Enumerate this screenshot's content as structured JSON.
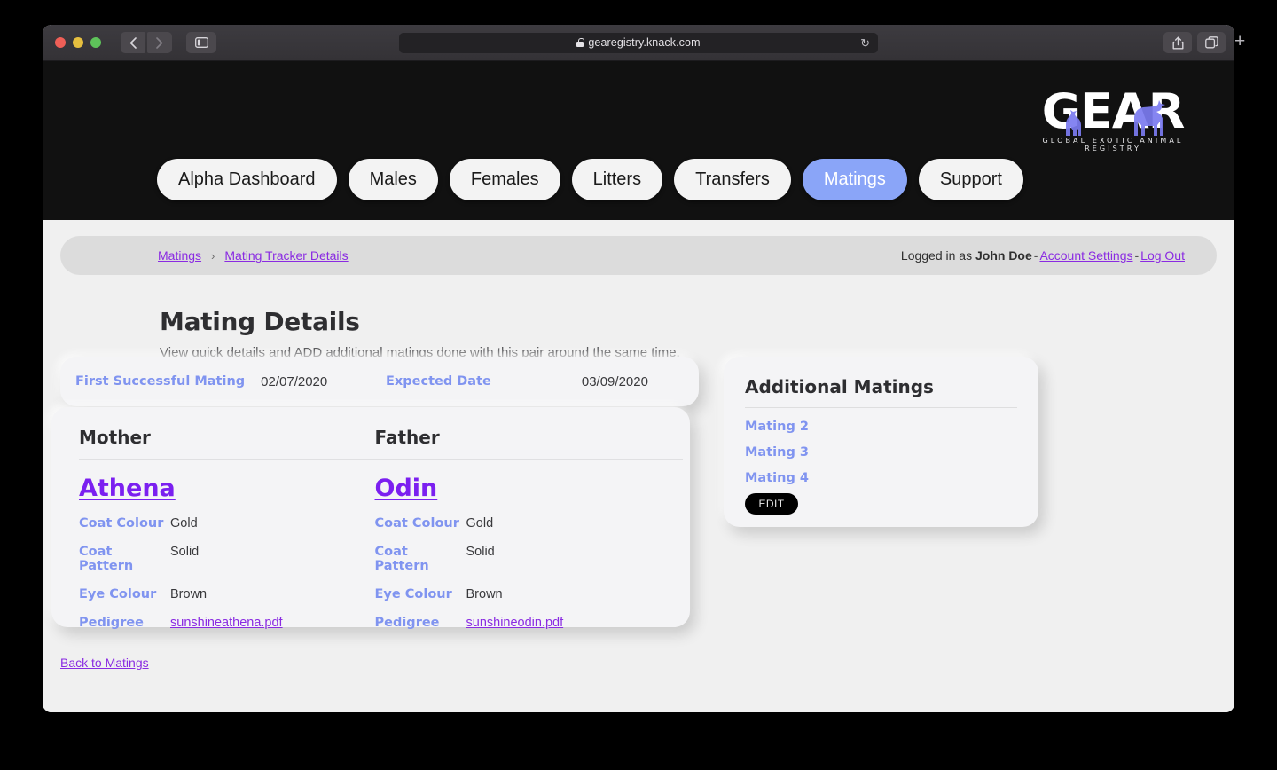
{
  "browser": {
    "url": "gearegistry.knack.com",
    "lock_icon": "lock-icon",
    "reload_icon": "↻",
    "back_icon": "‹",
    "forward_icon": "›",
    "sidebar_icon": "▥",
    "share_icon": "⇧",
    "tabs_icon": "❐",
    "newtab_icon": "+"
  },
  "site": {
    "logo_word": "GEAR",
    "logo_tagline": "GLOBAL EXOTIC ANIMAL REGISTRY"
  },
  "nav": {
    "items": [
      {
        "label": "Alpha Dashboard",
        "active": false
      },
      {
        "label": "Males",
        "active": false
      },
      {
        "label": "Females",
        "active": false
      },
      {
        "label": "Litters",
        "active": false
      },
      {
        "label": "Transfers",
        "active": false
      },
      {
        "label": "Matings",
        "active": true
      },
      {
        "label": "Support",
        "active": false
      }
    ]
  },
  "breadcrumb": {
    "items": [
      "Matings",
      "Mating Tracker Details"
    ],
    "separator": "›"
  },
  "account": {
    "prefix": "Logged in as",
    "user": "John Doe",
    "dash": "-",
    "settings_label": "Account Settings",
    "logout_label": "Log Out"
  },
  "main": {
    "title": "Mating Details",
    "subtitle": "View quick details and ADD additional matings done with this pair around the same time."
  },
  "summary": {
    "first_mating_label": "First Successful Mating",
    "first_mating_value": "02/07/2020",
    "expected_label": "Expected Date",
    "expected_value": "03/09/2020"
  },
  "parents": {
    "mother": {
      "heading": "Mother",
      "name": "Athena",
      "attrs": [
        {
          "label": "Coat Colour",
          "value": "Gold"
        },
        {
          "label": "Coat Pattern",
          "value": "Solid"
        },
        {
          "label": "Eye Colour",
          "value": "Brown"
        }
      ],
      "pedigree_label": "Pedigree",
      "pedigree_file": "sunshineathena.pdf"
    },
    "father": {
      "heading": "Father",
      "name": "Odin",
      "attrs": [
        {
          "label": "Coat Colour",
          "value": "Gold"
        },
        {
          "label": "Coat Pattern",
          "value": "Solid"
        },
        {
          "label": "Eye Colour",
          "value": "Brown"
        }
      ],
      "pedigree_label": "Pedigree",
      "pedigree_file": "sunshineodin.pdf"
    }
  },
  "additional_matings": {
    "heading": "Additional Matings",
    "links": [
      "Mating 2",
      "Mating 3",
      "Mating 4"
    ],
    "edit_label": "EDIT"
  },
  "footer": {
    "back_label": "Back to Matings"
  },
  "colors": {
    "accent_blue": "#8094f0",
    "active_tab": "#8aa5f8",
    "link_purple": "#8a2be2",
    "name_purple": "#7b1ff0",
    "header_dark": "#111111",
    "page_bg": "#f0f0f0",
    "card_bg": "#f4f4f6",
    "edit_btn_bg": "#000000"
  }
}
